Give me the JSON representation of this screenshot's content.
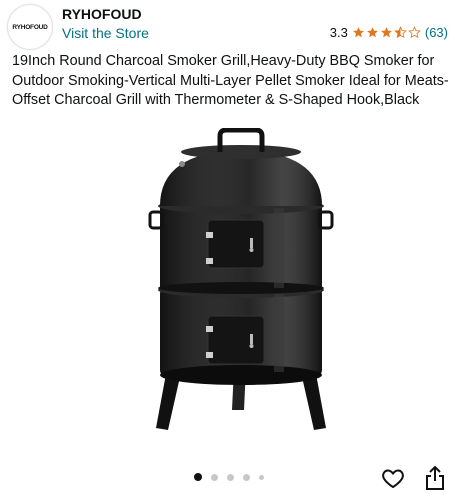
{
  "store": {
    "logo_text": "RYHOFOUD",
    "brand": "RYHOFOUD",
    "visit_link": "Visit the Store"
  },
  "rating": {
    "value": "3.3",
    "stars": 3.5,
    "count": "(63)",
    "star_color": "#de7921"
  },
  "product": {
    "title": "19Inch Round Charcoal Smoker Grill,Heavy-Duty BBQ Smoker for Outdoor Smoking-Vertical Multi-Layer Pellet Smoker Ideal for Meats-Offset Charcoal Grill with Thermometer & S-Shaped Hook,Black"
  },
  "gallery": {
    "current_index": 1,
    "dot_count": 5
  },
  "actions": {
    "favorite_icon": "heart-icon",
    "share_icon": "share-icon"
  },
  "colors": {
    "link": "#007185",
    "text": "#0f1111"
  }
}
